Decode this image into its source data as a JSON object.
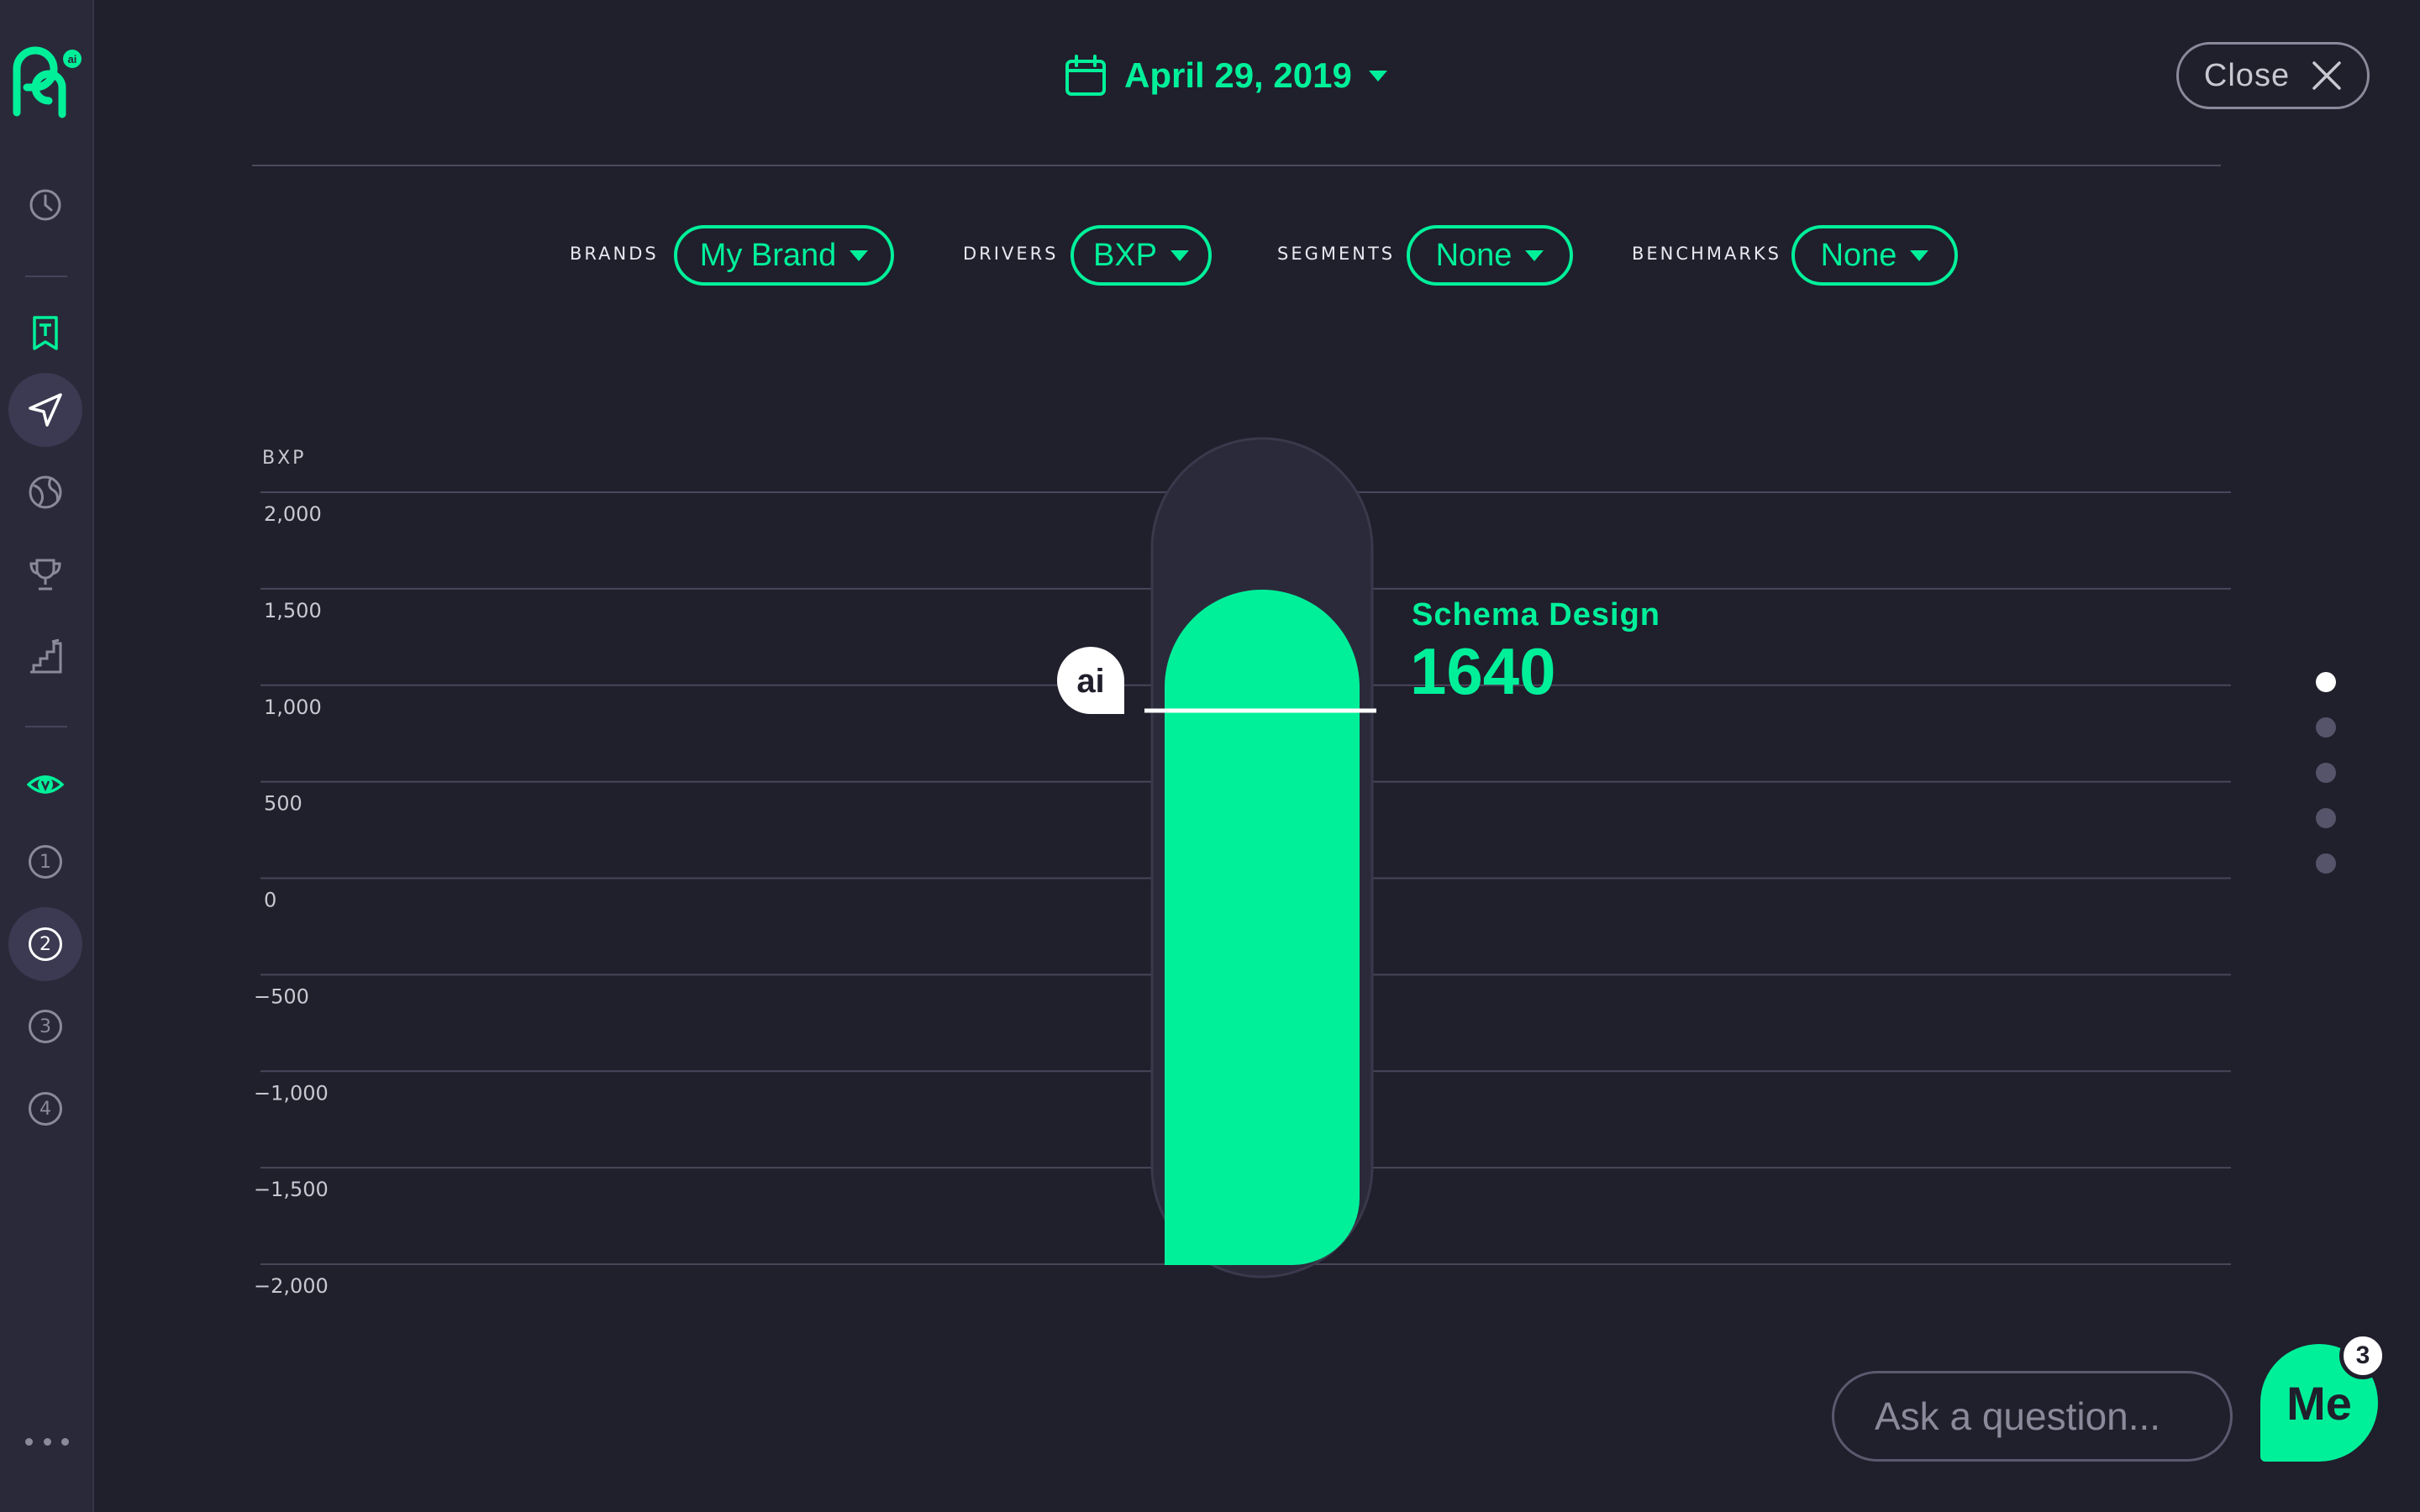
{
  "colors": {
    "accent": "#00f09a",
    "background": "#201f2c",
    "sidebar": "#2a2939"
  },
  "sidebar": {
    "logo_icon": "pq-ai-logo",
    "items": [
      {
        "icon": "clock-icon"
      },
      {
        "icon": "bookmark-t-icon"
      },
      {
        "icon": "send-icon",
        "active": true
      },
      {
        "icon": "globe-icon"
      },
      {
        "icon": "trophy-icon"
      },
      {
        "icon": "stairs-icon"
      },
      {
        "icon": "eye-v-icon"
      },
      {
        "label": "1"
      },
      {
        "label": "2",
        "active": true
      },
      {
        "label": "3"
      },
      {
        "label": "4"
      }
    ],
    "more_icon": "more-dots-icon"
  },
  "header": {
    "date": "April 29, 2019",
    "close_label": "Close"
  },
  "filters": {
    "brands": {
      "label": "BRANDS",
      "value": "My Brand"
    },
    "drivers": {
      "label": "DRIVERS",
      "value": "BXP"
    },
    "segments": {
      "label": "SEGMENTS",
      "value": "None"
    },
    "benchmarks": {
      "label": "BENCHMARKS",
      "value": "None"
    }
  },
  "chart_data": {
    "type": "bar",
    "ylabel": "BXP",
    "ylim": [
      -2000,
      2000
    ],
    "yticks": [
      2000,
      1500,
      1000,
      500,
      0,
      -500,
      -1000,
      -1500,
      -2000
    ],
    "ytick_labels": [
      "2,000",
      "1,500",
      "1,000",
      "500",
      "0",
      "−500",
      "−1,000",
      "−1,500",
      "−2,000"
    ],
    "categories": [
      "Schema Design"
    ],
    "values": [
      1640
    ],
    "value_label": "1640",
    "benchmark_line": 1000,
    "benchmark_marker": "ai",
    "grid": true
  },
  "pager": {
    "count": 5,
    "active": 0
  },
  "ask": {
    "placeholder": "Ask a question..."
  },
  "me_button": {
    "label": "Me",
    "badge": "3"
  }
}
